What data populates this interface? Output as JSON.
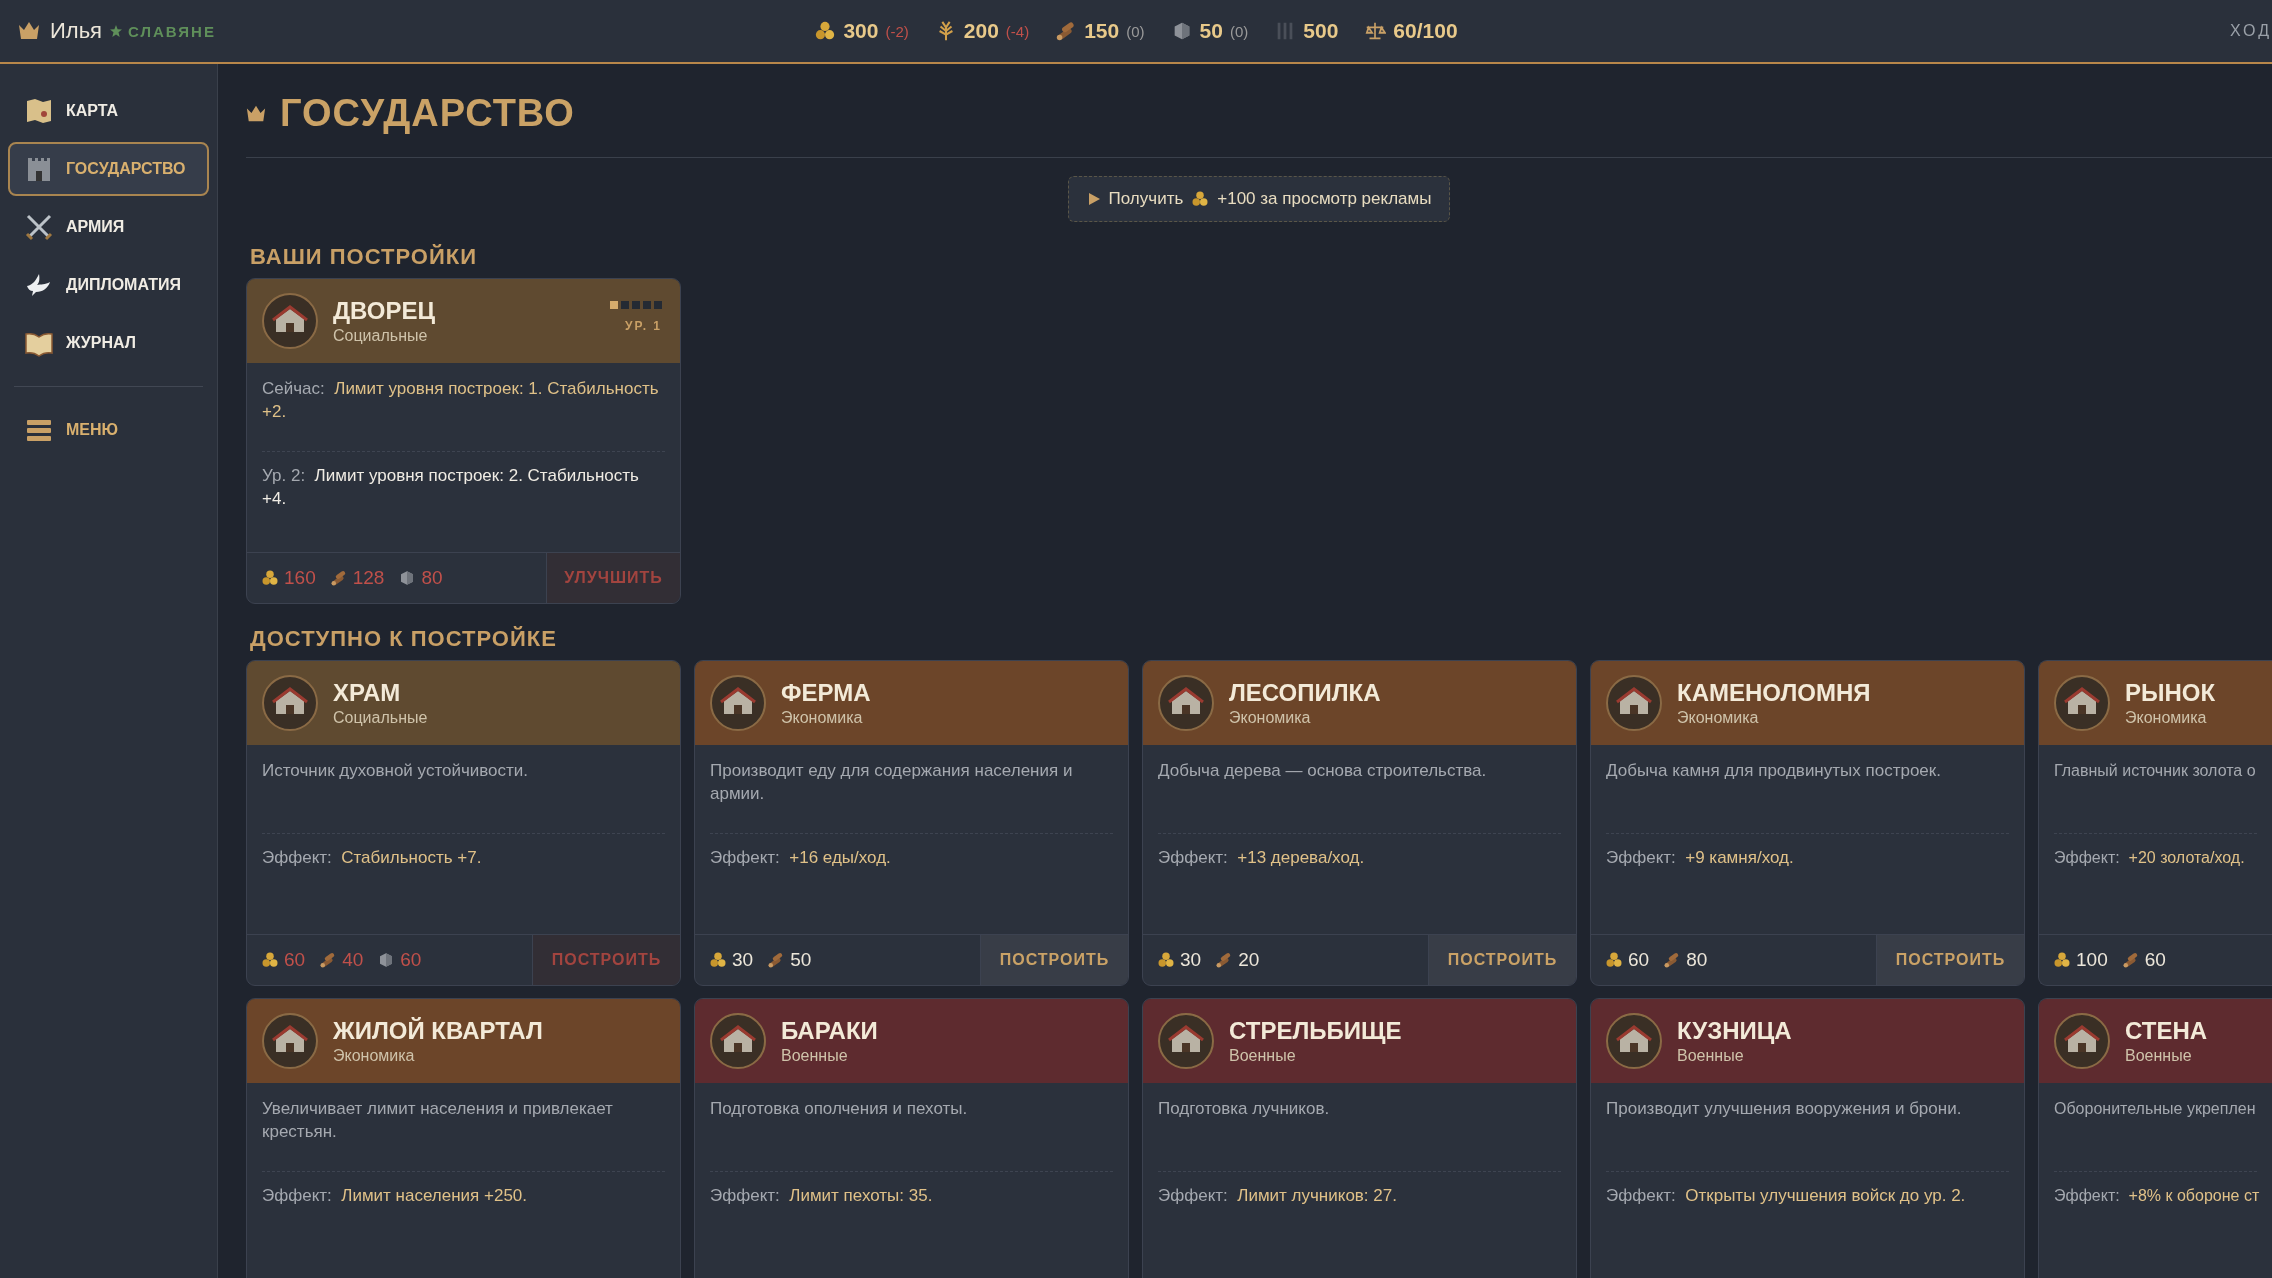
{
  "top_bar": {
    "player": "Илья",
    "faction": "СЛАВЯНЕ",
    "turn_label": "ХОД",
    "resources": [
      {
        "kind": "gold",
        "value": "300",
        "delta": "(-2)",
        "color": "#c0504a"
      },
      {
        "kind": "food",
        "value": "200",
        "delta": "(-4)",
        "color": "#c0504a"
      },
      {
        "kind": "wood",
        "value": "150",
        "delta": "(0)",
        "color": "#9a9a9a"
      },
      {
        "kind": "stone",
        "value": "50",
        "delta": "(0)",
        "color": "#9a9a9a"
      },
      {
        "kind": "population",
        "value": "500"
      },
      {
        "kind": "stability",
        "value": "60/100"
      }
    ]
  },
  "sidebar": {
    "items": [
      {
        "kind": "map",
        "label": "КАРТА",
        "selected": false
      },
      {
        "kind": "castle",
        "label": "ГОСУДАРСТВО",
        "selected": true
      },
      {
        "kind": "swords",
        "label": "АРМИЯ",
        "selected": false
      },
      {
        "kind": "dove",
        "label": "ДИПЛОМАТИЯ",
        "selected": false
      },
      {
        "kind": "book",
        "label": "ЖУРНАЛ",
        "selected": false
      }
    ],
    "menu": {
      "label": "МЕНЮ"
    }
  },
  "page": {
    "title": "ГОСУДАРСТВО",
    "ad_button": {
      "prefix": "Получить",
      "text": "+100 за просмотр рекламы"
    }
  },
  "your_buildings": {
    "heading": "ВАШИ ПОСТРОЙКИ",
    "cards": [
      {
        "title": "ДВОРЕЦ",
        "category": "Социальные",
        "kind": "social",
        "level": 0.2,
        "level_label": "УР. 1",
        "lines": [
          {
            "kind": "current",
            "label": "Сейчас:",
            "text": "Лимит уровня построек: 1. Стабильность +2."
          },
          {
            "kind": "next",
            "label": "Ур. 2:",
            "text": "Лимит уровня построек: 2. Стабильность +4."
          }
        ],
        "costs": [
          {
            "kind": "gold",
            "value": "160"
          },
          {
            "kind": "wood",
            "value": "128"
          },
          {
            "kind": "stone",
            "value": "80"
          }
        ],
        "affordable": false,
        "action": "УЛУЧШИТЬ"
      }
    ]
  },
  "available": {
    "heading": "ДОСТУПНО К ПОСТРОЙКЕ",
    "cards": [
      {
        "title": "ХРАМ",
        "category": "Социальные",
        "kind": "social",
        "description": "Источник духовной устойчивости.",
        "effect_label": "Эффект:",
        "effect": "Стабильность +7.",
        "costs": [
          {
            "kind": "gold",
            "value": "60"
          },
          {
            "kind": "wood",
            "value": "40"
          },
          {
            "kind": "stone",
            "value": "60"
          }
        ],
        "affordable": false,
        "action": "ПОСТРОИТЬ"
      },
      {
        "title": "ФЕРМА",
        "category": "Экономика",
        "kind": "economy",
        "description": "Производит еду для содержания населения и армии.",
        "effect_label": "Эффект:",
        "effect": "+16 еды/ход.",
        "costs": [
          {
            "kind": "gold",
            "value": "30"
          },
          {
            "kind": "wood",
            "value": "50"
          }
        ],
        "affordable": true,
        "action": "ПОСТРОИТЬ"
      },
      {
        "title": "ЛЕСОПИЛКА",
        "category": "Экономика",
        "kind": "economy",
        "description": "Добыча дерева — основа строительства.",
        "effect_label": "Эффект:",
        "effect": "+13 дерева/ход.",
        "costs": [
          {
            "kind": "gold",
            "value": "30"
          },
          {
            "kind": "wood",
            "value": "20"
          }
        ],
        "affordable": true,
        "action": "ПОСТРОИТЬ"
      },
      {
        "title": "КАМЕНОЛОМНЯ",
        "category": "Экономика",
        "kind": "economy",
        "description": "Добыча камня для продвинутых построек.",
        "effect_label": "Эффект:",
        "effect": "+9 камня/ход.",
        "costs": [
          {
            "kind": "gold",
            "value": "60"
          },
          {
            "kind": "wood",
            "value": "80"
          }
        ],
        "affordable": true,
        "action": "ПОСТРОИТЬ"
      },
      {
        "title": "РЫНОК",
        "category": "Экономика",
        "kind": "economy",
        "description": "Главный источник золота о",
        "effect_label": "Эффект:",
        "effect": "+20 золота/ход.",
        "costs": [
          {
            "kind": "gold",
            "value": "100"
          },
          {
            "kind": "wood",
            "value": "60"
          }
        ],
        "affordable": true
      },
      {
        "title": "ЖИЛОЙ КВАРТАЛ",
        "category": "Экономика",
        "kind": "economy",
        "description": "Увеличивает лимит населения и привлекает крестьян.",
        "effect_label": "Эффект:",
        "effect": "Лимит населения +250."
      },
      {
        "title": "БАРАКИ",
        "category": "Военные",
        "kind": "military",
        "description": "Подготовка ополчения и пехоты.",
        "effect_label": "Эффект:",
        "effect": "Лимит пехоты: 35."
      },
      {
        "title": "СТРЕЛЬБИЩЕ",
        "category": "Военные",
        "kind": "military",
        "description": "Подготовка лучников.",
        "effect_label": "Эффект:",
        "effect": "Лимит лучников: 27."
      },
      {
        "title": "КУЗНИЦА",
        "category": "Военные",
        "kind": "military",
        "description": "Производит улучшения вооружения и брони.",
        "effect_label": "Эффект:",
        "effect": "Открыты улучшения войск до ур. 2."
      },
      {
        "title": "СТЕНА",
        "category": "Военные",
        "kind": "military",
        "description": "Оборонительные укреплен",
        "effect_label": "Эффект:",
        "effect": "+8% к обороне ст"
      }
    ]
  }
}
